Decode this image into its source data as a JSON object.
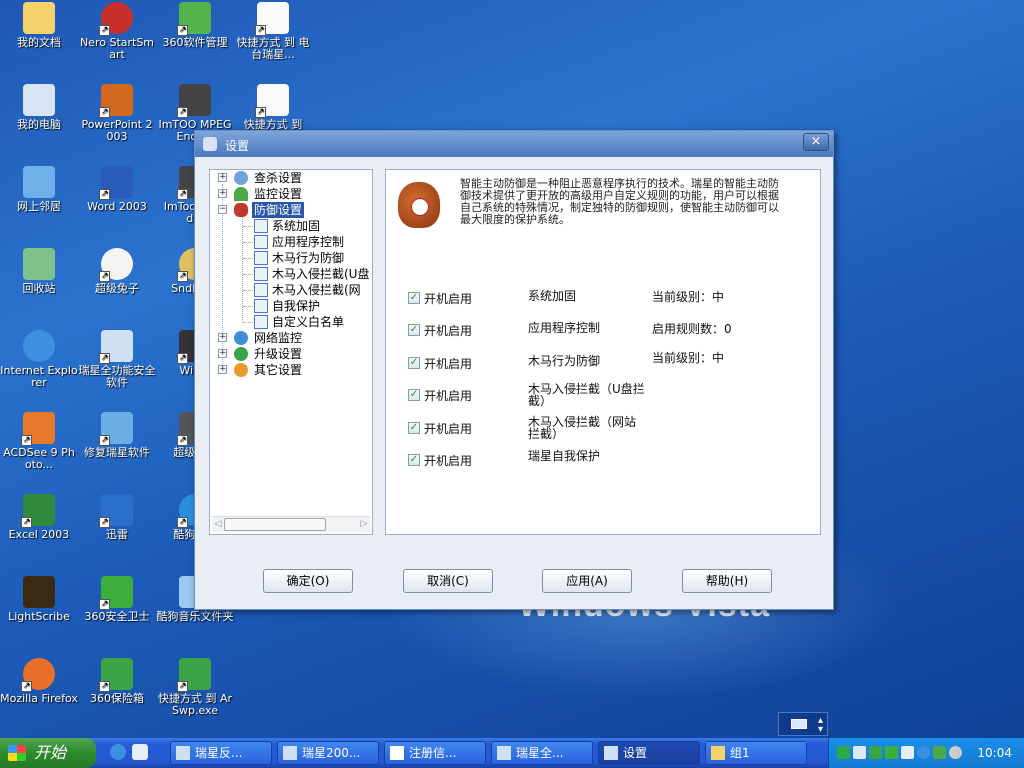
{
  "desktop": {
    "icons": [
      {
        "label": "我的文档"
      },
      {
        "label": "Nero StartSmart"
      },
      {
        "label": "360软件管理"
      },
      {
        "label": "快捷方式 到 电台瑞星..."
      },
      {
        "label": "我的电脑"
      },
      {
        "label": "PowerPoint 2003"
      },
      {
        "label": "ImTOO MPEG Enco..."
      },
      {
        "label": "快捷方式 到"
      },
      {
        "label": "网上邻居"
      },
      {
        "label": "Word 2003"
      },
      {
        "label": "ImToo Encod..."
      },
      {
        "label": "回收站"
      },
      {
        "label": "超级兔子"
      },
      {
        "label": "SndMa..."
      },
      {
        "label": "Internet Explorer"
      },
      {
        "label": "瑞星全功能安全软件"
      },
      {
        "label": "Win..."
      },
      {
        "label": "ACDSee 9 Photo..."
      },
      {
        "label": "修复瑞星软件"
      },
      {
        "label": "超级解..."
      },
      {
        "label": "Excel 2003"
      },
      {
        "label": "迅雷"
      },
      {
        "label": "酷狗音..."
      },
      {
        "label": "LightScribe"
      },
      {
        "label": "360安全卫士"
      },
      {
        "label": "酷狗音乐文件夹"
      },
      {
        "label": "Mozilla Firefox"
      },
      {
        "label": "360保险箱"
      },
      {
        "label": "快捷方式 到 ArSwp.exe"
      }
    ],
    "wallpaper_text": "Windows Vista"
  },
  "dialog": {
    "title": "设置",
    "close_label": "×",
    "tree": {
      "kill_settings": "查杀设置",
      "monitor_settings": "监控设置",
      "defense_settings": "防御设置",
      "children": [
        "系统加固",
        "应用程序控制",
        "木马行为防御",
        "木马入侵拦截(U盘",
        "木马入侵拦截(网",
        "自我保护",
        "自定义白名单"
      ],
      "network_monitor": "网络监控",
      "upgrade_settings": "升级设置",
      "other_settings": "其它设置"
    },
    "description": "智能主动防御是一种阻止恶意程序执行的技术。瑞星的智能主动防御技术提供了更开放的高级用户自定义规则的功能，用户可以根据自己系统的特殊情况，制定独特的防御规则，使智能主动防御可以最大限度的保护系统。",
    "rows": [
      {
        "checkbox": "开机启用",
        "name": "系统加固",
        "status": "当前级别：中"
      },
      {
        "checkbox": "开机启用",
        "name": "应用程序控制",
        "status": "启用规则数：0"
      },
      {
        "checkbox": "开机启用",
        "name": "木马行为防御",
        "status": "当前级别：中"
      },
      {
        "checkbox": "开机启用",
        "name": "木马入侵拦截（U盘拦截）",
        "status": ""
      },
      {
        "checkbox": "开机启用",
        "name": "木马入侵拦截（网站拦截）",
        "status": ""
      },
      {
        "checkbox": "开机启用",
        "name": "瑞星自我保护",
        "status": ""
      }
    ],
    "buttons": {
      "ok": "确定(O)",
      "cancel": "取消(C)",
      "apply": "应用(A)",
      "help": "帮助(H)"
    }
  },
  "taskbar": {
    "start_label": "开始",
    "tasks": [
      {
        "label": "瑞星反..."
      },
      {
        "label": "瑞星200..."
      },
      {
        "label": "注册信..."
      },
      {
        "label": "瑞星全..."
      },
      {
        "label": "设置"
      },
      {
        "label": "组1"
      }
    ],
    "clock": "10:04"
  },
  "colors": {
    "desktop": "#1f58b4",
    "titlebar": "#4b78bf",
    "selection": "#2b55a8"
  }
}
